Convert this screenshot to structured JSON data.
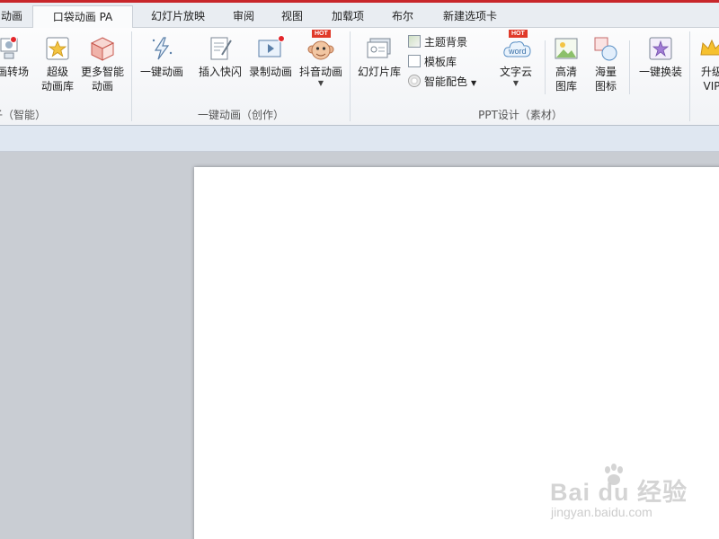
{
  "tabs": [
    {
      "label": "动画"
    },
    {
      "label": "口袋动画 PA"
    },
    {
      "label": "幻灯片放映"
    },
    {
      "label": "审阅"
    },
    {
      "label": "视图"
    },
    {
      "label": "加载项"
    },
    {
      "label": "布尔"
    },
    {
      "label": "新建选项卡"
    }
  ],
  "ribbon": {
    "group1": {
      "label": "子（智能）",
      "buttons": [
        {
          "label1": "画转场",
          "label2": ""
        },
        {
          "label1": "超级",
          "label2": "动画库"
        },
        {
          "label1": "更多智能",
          "label2": "动画"
        }
      ]
    },
    "group2": {
      "label": "一键动画（创作）",
      "buttons": [
        {
          "label1": "一键动画"
        },
        {
          "label1": "插入快闪"
        },
        {
          "label1": "录制动画"
        },
        {
          "label1": "抖音动画",
          "hot": "HOT"
        }
      ]
    },
    "group3": {
      "label": "PPT设计（素材）",
      "slide_library": "幻灯片库",
      "small": [
        {
          "label": "主题背景"
        },
        {
          "label": "模板库"
        },
        {
          "label": "智能配色"
        }
      ],
      "word_cloud": {
        "label": "文字云",
        "hot": "HOT",
        "icon_text": "word"
      },
      "hd_images": {
        "label1": "高清",
        "label2": "图库"
      },
      "icons": {
        "label1": "海量",
        "label2": "图标"
      }
    },
    "group4": {
      "one_click_change": "一键换装",
      "upgrade": {
        "label1": "升级",
        "label2": "VIP"
      }
    }
  },
  "watermark": {
    "brand": "Bai du 经验",
    "url": "jingyan.baidu.com"
  },
  "colors": {
    "accent_red": "#c8262a",
    "ribbon_bg": "#f4f6f8",
    "workspace": "#c9cdd3",
    "subbar": "#dfe7f1"
  }
}
